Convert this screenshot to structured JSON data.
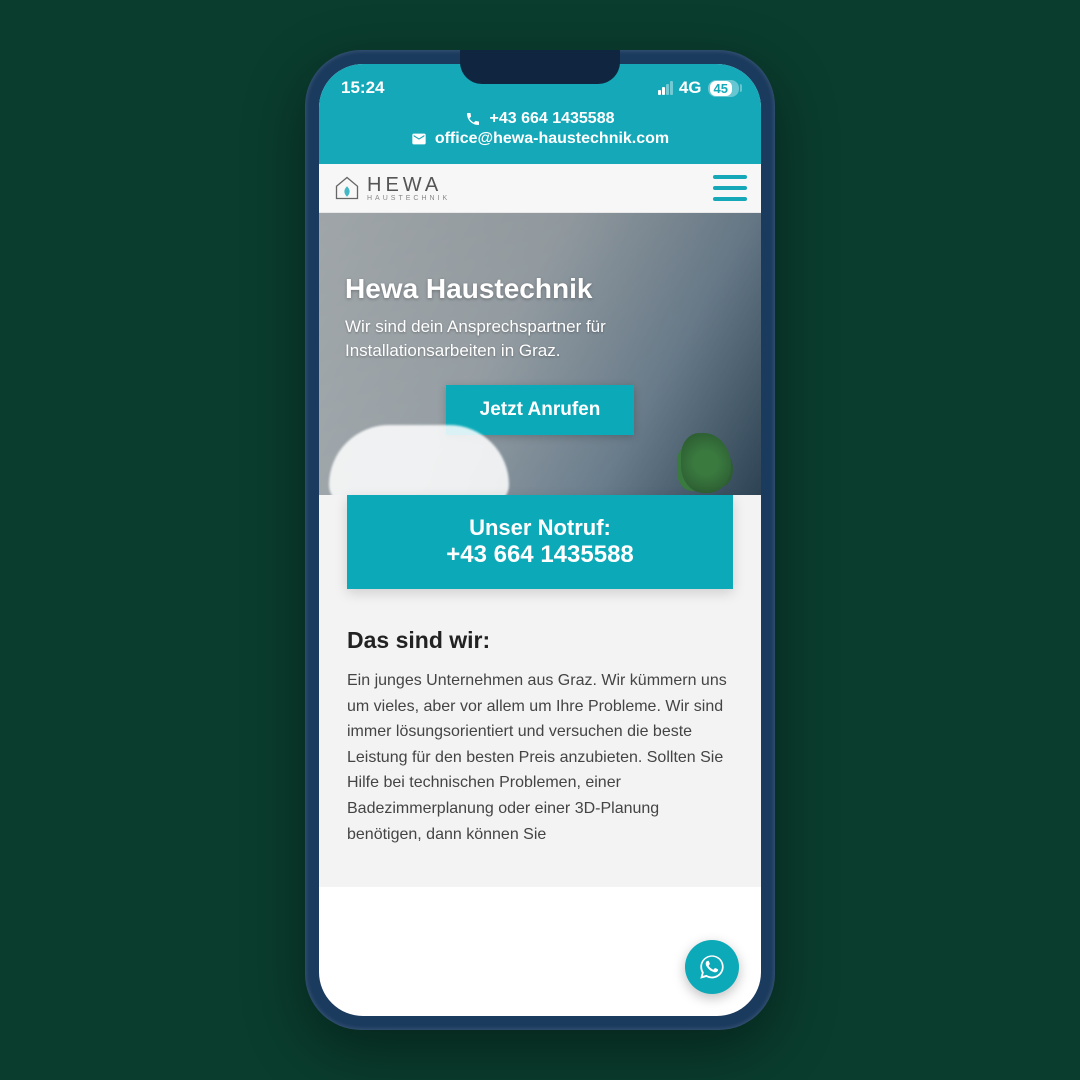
{
  "status": {
    "time": "15:24",
    "network": "4G",
    "battery": "45"
  },
  "topbar": {
    "phone": "+43 664 1435588",
    "email": "office@hewa-haustechnik.com"
  },
  "logo": {
    "main": "HEWA",
    "sub": "HAUSTECHNIK"
  },
  "hero": {
    "title": "Hewa Haustechnik",
    "subtitle": "Wir sind dein Ansprechspartner für Installationsarbeiten in Graz.",
    "cta": "Jetzt Anrufen"
  },
  "notruf": {
    "label": "Unser Notruf:",
    "number": "+43 664 1435588"
  },
  "about": {
    "heading": "Das sind wir:",
    "body": "Ein junges Unternehmen aus Graz. Wir kümmern uns um vieles, aber vor allem um Ihre Probleme.\nWir sind immer lösungsorientiert und versuchen die beste Leistung für den besten Preis anzubieten.\nSollten Sie Hilfe bei technischen Problemen, einer Badezimmerplanung oder einer 3D-Planung benötigen, dann können Sie"
  },
  "colors": {
    "accent": "#0ca9b8",
    "header": "#15a8b8"
  }
}
